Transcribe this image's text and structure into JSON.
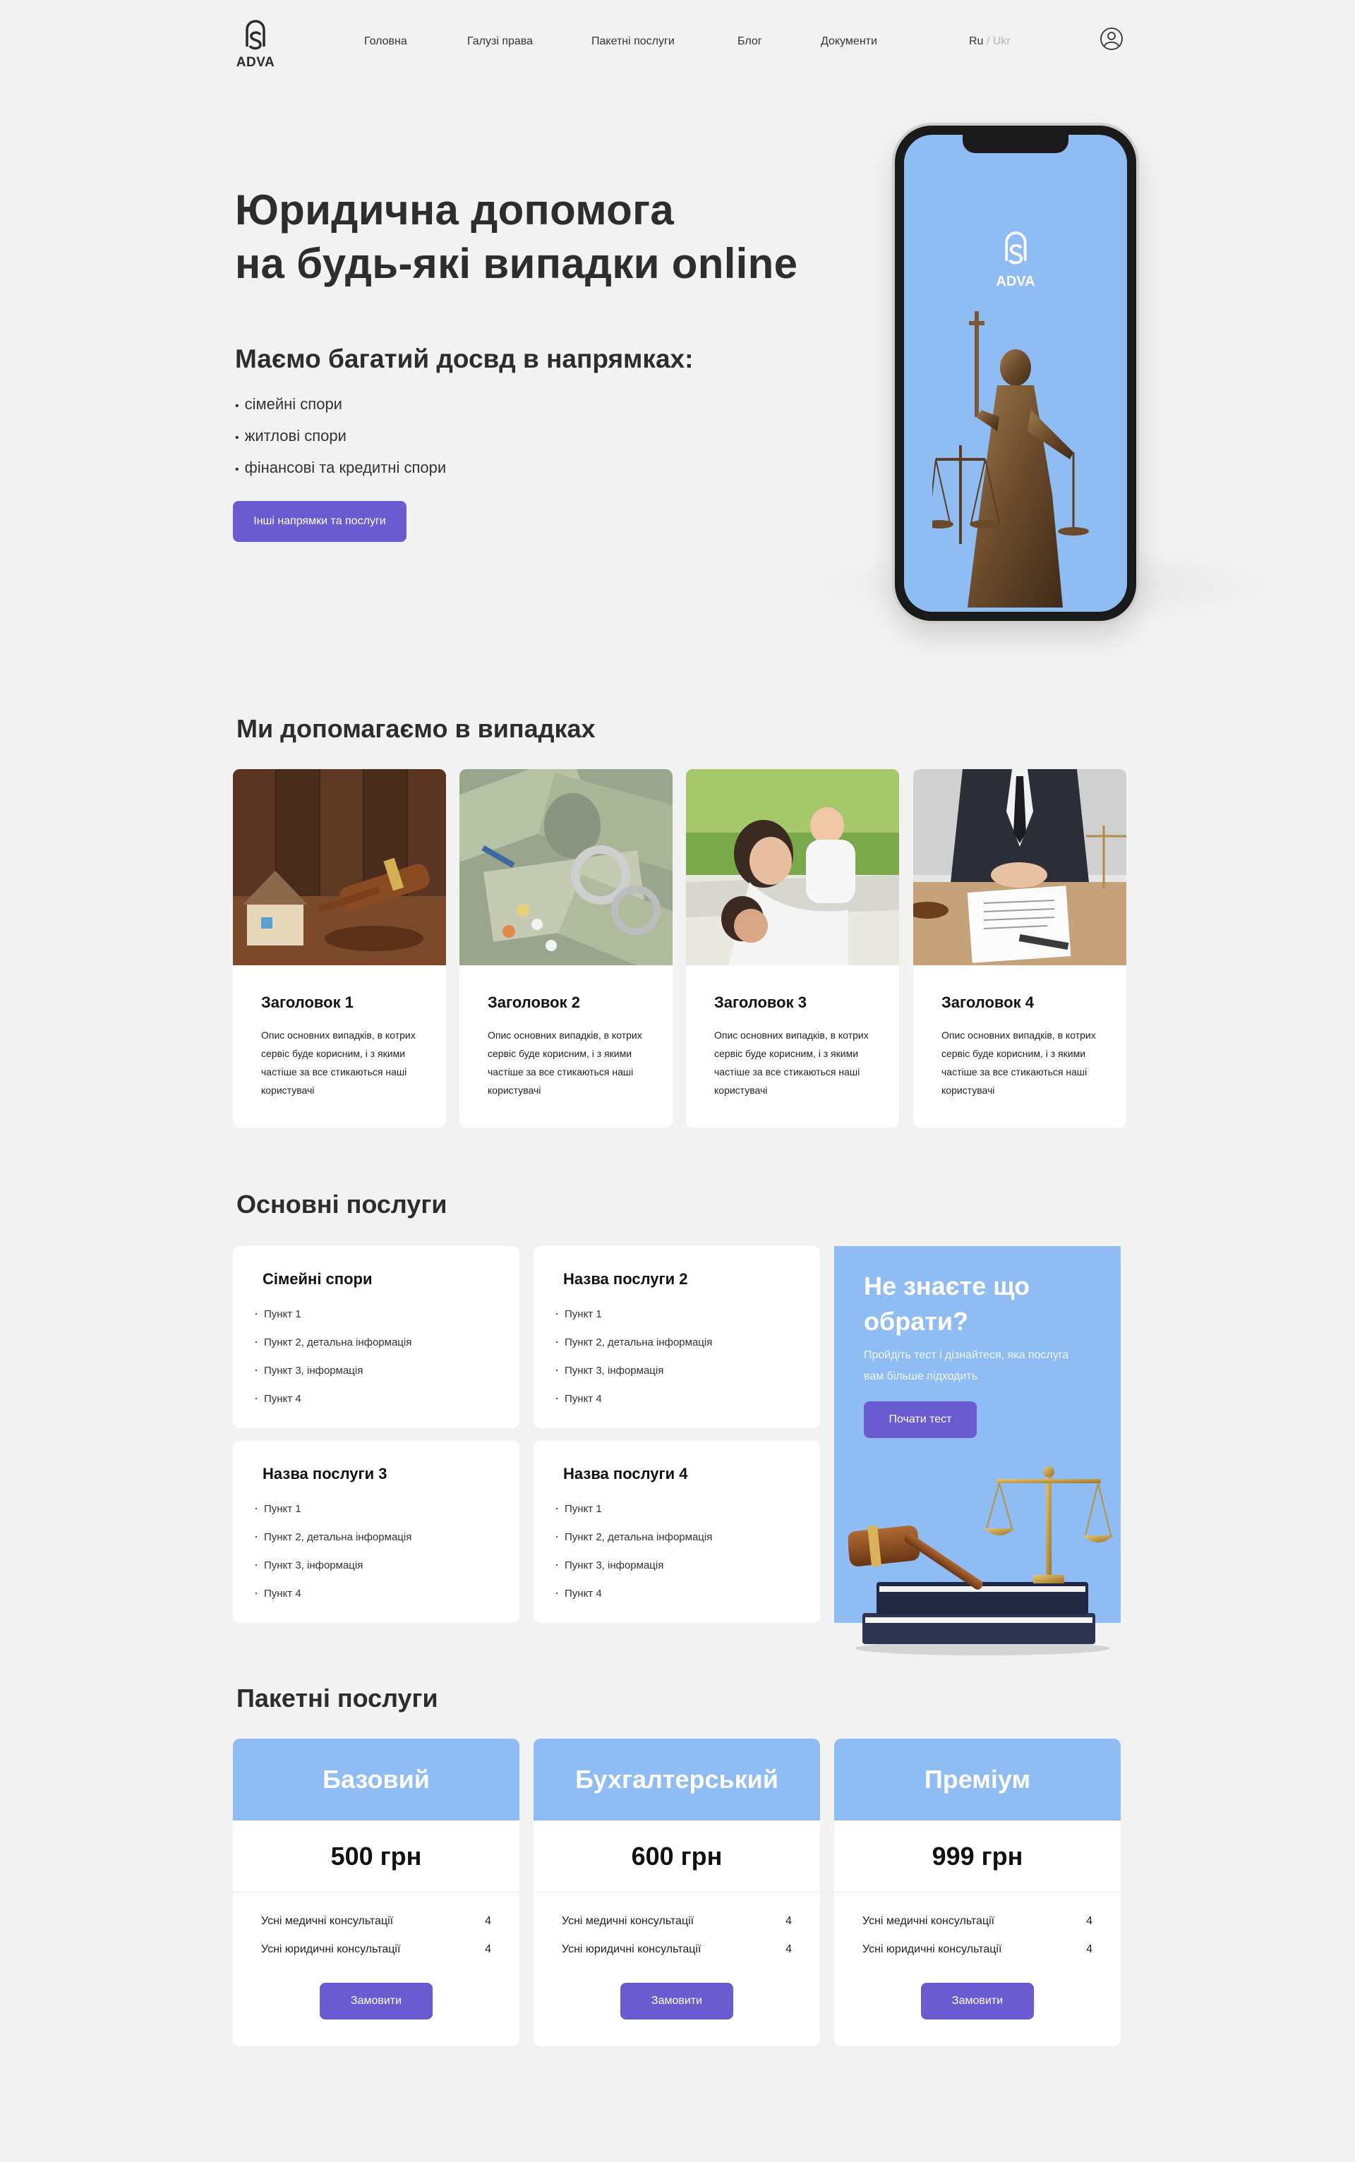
{
  "header": {
    "logo_text": "ADVA",
    "nav": [
      "Головна",
      "Галузі права",
      "Пакетні послуги",
      "Блог",
      "Документи"
    ],
    "lang_active": "Ru",
    "lang_sep": "/",
    "lang_inactive": "Ukr"
  },
  "hero": {
    "title_line1": "Юридична допомога",
    "title_line2": "на будь-які випадки online",
    "subtitle": "Маємо багатий досвд в напрямках:",
    "items": [
      "сімейні спори",
      "житлові спори",
      "фінансові та кредитні спори"
    ],
    "button": "Інші напрямки та послуги",
    "phone_logo_text": "ADVA"
  },
  "cases": {
    "title": "Ми допомагаємо в випадках",
    "cards": [
      {
        "title": "Заголовок 1",
        "desc": "Опис основних випадків, в котрих сервіс буде корисним, і з якими частіше за все стикаються наші користувачі"
      },
      {
        "title": "Заголовок 2",
        "desc": "Опис основних випадків, в котрих сервіс буде корисним, і з якими частіше за все стикаються наші користувачі"
      },
      {
        "title": "Заголовок 3",
        "desc": "Опис основних випадків, в котрих сервіс буде корисним, і з якими частіше за все стикаються наші користувачі"
      },
      {
        "title": "Заголовок 4",
        "desc": "Опис основних випадків, в котрих сервіс буде корисним, і з якими частіше за все стикаються наші користувачі"
      }
    ]
  },
  "services": {
    "title": "Основні послуги",
    "cards": [
      {
        "title": "Сімейні спори",
        "items": [
          "Пункт 1",
          "Пункт 2, детальна інформація",
          "Пункт 3, інформація",
          "Пункт 4"
        ]
      },
      {
        "title": "Назва послуги 2",
        "items": [
          "Пункт 1",
          "Пункт 2, детальна інформація",
          "Пункт 3, інформація",
          "Пункт 4"
        ]
      },
      {
        "title": "Назва послуги 3",
        "items": [
          "Пункт 1",
          "Пункт 2, детальна інформація",
          "Пункт 3, інформація",
          "Пункт 4"
        ]
      },
      {
        "title": "Назва послуги 4",
        "items": [
          "Пункт 1",
          "Пункт 2, детальна інформація",
          "Пункт 3, інформація",
          "Пункт 4"
        ]
      }
    ],
    "promo": {
      "title": "Не знаєте що обрати?",
      "text": "Пройдіть тест і дізнайтеся, яка послуга вам більше підходить",
      "button": "Почати тест"
    }
  },
  "packages": {
    "title": "Пакетні послуги",
    "cards": [
      {
        "name": "Базовий",
        "price": "500 грн",
        "rows": [
          {
            "label": "Усні медичні консультації",
            "value": "4"
          },
          {
            "label": "Усні юридичні консультації",
            "value": "4"
          }
        ],
        "button": "Замовити"
      },
      {
        "name": "Бухгалтерський",
        "price": "600 грн",
        "rows": [
          {
            "label": "Усні медичні консультації",
            "value": "4"
          },
          {
            "label": "Усні юридичні консультації",
            "value": "4"
          }
        ],
        "button": "Замовити"
      },
      {
        "name": "Преміум",
        "price": "999 грн",
        "rows": [
          {
            "label": "Усні медичні консультації",
            "value": "4"
          },
          {
            "label": "Усні юридичні консультації",
            "value": "4"
          }
        ],
        "button": "Замовити"
      }
    ]
  },
  "colors": {
    "accent": "#6b5bd1",
    "light_blue": "#8fbcf2",
    "background": "#f2f2f2"
  }
}
